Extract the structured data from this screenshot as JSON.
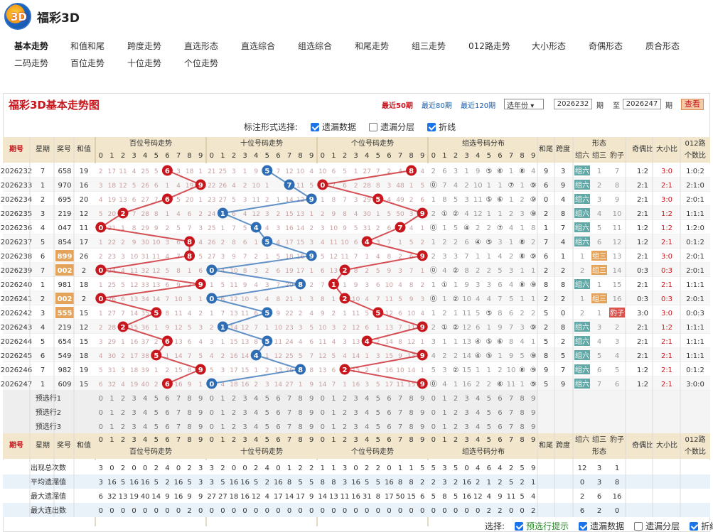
{
  "app": {
    "title": "福彩3D"
  },
  "nav": [
    "基本走势",
    "和值和尾",
    "跨度走势",
    "直选形态",
    "直选综合",
    "组选综合",
    "和尾走势",
    "组三走势",
    "012路走势",
    "大小形态",
    "奇偶形态",
    "质合形态",
    "二码走势",
    "百位走势",
    "十位走势",
    "个位走势"
  ],
  "panel": {
    "title": "福彩3D基本走势图",
    "recent50": "最近50期",
    "recent80": "最近80期",
    "recent120": "最近120期",
    "year_select": "选年份",
    "from_val": "2026232",
    "from_unit": "期",
    "to_label": "至",
    "to_val": "2026247",
    "to_unit": "期",
    "view_btn": "查看"
  },
  "options": {
    "label": "标注形式选择:",
    "missing": "遗漏数据",
    "layer": "遗漏分层",
    "line": "折线"
  },
  "header": {
    "issue": "期号",
    "week": "星期",
    "prize": "奖号",
    "sum": "和值",
    "hundreds": "百位号码走势",
    "tens": "十位号码走势",
    "units": "个位号码走势",
    "group": "组选号码分布",
    "tail": "和尾",
    "span": "跨度",
    "form": "形态",
    "g6": "组六",
    "g3": "组三",
    "leopard": "豹子",
    "odd_even": "奇偶比",
    "big_small": "大小比",
    "route": "012路",
    "route2": "个数比"
  },
  "digits": [
    "0",
    "1",
    "2",
    "3",
    "4",
    "5",
    "6",
    "7",
    "8",
    "9"
  ],
  "rows": [
    {
      "issue": "2026232",
      "week": "7",
      "prize": "658",
      "sum": "19",
      "h": 6,
      "t": 5,
      "u": 8,
      "hm": [
        "2",
        "17",
        "11",
        "4",
        "25",
        "5",
        "",
        "3",
        "18",
        "1"
      ],
      "tm": [
        "21",
        "25",
        "3",
        "1",
        "9",
        "",
        "7",
        "12",
        "10",
        "4"
      ],
      "um": [
        "10",
        "6",
        "5",
        "1",
        "27",
        "7",
        "2",
        "4",
        "",
        "4"
      ],
      "g": [
        "2",
        "6",
        "3",
        "1",
        "9",
        "⑤",
        "⑥",
        "1",
        "⑧",
        "4"
      ],
      "tail": "9",
      "span": "3",
      "form": "组六",
      "f3": "1",
      "f4": "7",
      "oe": "1:2",
      "bs": "3:0",
      "rt": "1:0:2"
    },
    {
      "issue": "2026233",
      "week": "1",
      "prize": "970",
      "sum": "16",
      "h": 9,
      "t": 7,
      "u": 0,
      "hm": [
        "3",
        "18",
        "12",
        "5",
        "26",
        "6",
        "1",
        "4",
        "19",
        ""
      ],
      "tm": [
        "22",
        "26",
        "4",
        "2",
        "10",
        "1",
        "",
        "13",
        "11",
        "5"
      ],
      "um": [
        "",
        "7",
        "6",
        "2",
        "28",
        "8",
        "3",
        "48",
        "1",
        "5"
      ],
      "g": [
        "⓪",
        "7",
        "4",
        "2",
        "10",
        "1",
        "1",
        "⑦",
        "1",
        "⑨"
      ],
      "tail": "6",
      "span": "9",
      "form": "组六",
      "f3": "2",
      "f4": "8",
      "oe": "2:1",
      "bs": "2:1",
      "rt": "2:1:0"
    },
    {
      "issue": "2026234",
      "week": "2",
      "prize": "695",
      "sum": "20",
      "h": 6,
      "t": 9,
      "u": 5,
      "hm": [
        "4",
        "19",
        "13",
        "6",
        "27",
        "7",
        "",
        "5",
        "20",
        "1"
      ],
      "tm": [
        "23",
        "27",
        "5",
        "3",
        "11",
        "2",
        "1",
        "14",
        "12",
        ""
      ],
      "um": [
        "1",
        "8",
        "7",
        "3",
        "29",
        "",
        "4",
        "49",
        "2",
        "6"
      ],
      "g": [
        "1",
        "8",
        "5",
        "3",
        "11",
        "⑤",
        "⑥",
        "1",
        "2",
        "⑨"
      ],
      "tail": "0",
      "span": "4",
      "form": "组六",
      "f3": "3",
      "f4": "9",
      "oe": "2:1",
      "bs": "3:0",
      "rt": "2:0:1"
    },
    {
      "issue": "2026235",
      "week": "3",
      "prize": "219",
      "sum": "12",
      "h": 2,
      "t": 1,
      "u": 9,
      "hm": [
        "5",
        "20",
        "",
        "7",
        "28",
        "8",
        "1",
        "4",
        "6",
        "2"
      ],
      "tm": [
        "24",
        "",
        "6",
        "4",
        "12",
        "3",
        "2",
        "15",
        "13",
        "1"
      ],
      "um": [
        "2",
        "9",
        "8",
        "4",
        "30",
        "1",
        "5",
        "50",
        "3",
        ""
      ],
      "g": [
        "2",
        "①",
        "②",
        "4",
        "12",
        "1",
        "1",
        "2",
        "3",
        "⑨"
      ],
      "tail": "2",
      "span": "8",
      "form": "组六",
      "f3": "4",
      "f4": "10",
      "oe": "2:1",
      "bs": "1:2",
      "rt": "1:1:1"
    },
    {
      "issue": "2026236",
      "week": "4",
      "prize": "047",
      "sum": "11",
      "h": 0,
      "t": 4,
      "u": 7,
      "hm": [
        "",
        "21",
        "1",
        "8",
        "29",
        "9",
        "2",
        "5",
        "7",
        "3"
      ],
      "tm": [
        "25",
        "1",
        "7",
        "5",
        "",
        "4",
        "3",
        "16",
        "14",
        "2"
      ],
      "um": [
        "3",
        "10",
        "9",
        "5",
        "31",
        "2",
        "6",
        "",
        "4",
        "1"
      ],
      "g": [
        "⓪",
        "1",
        "5",
        "④",
        "2",
        "2",
        "⑦",
        "4",
        "1",
        "8"
      ],
      "tail": "1",
      "span": "7",
      "form": "组六",
      "f3": "5",
      "f4": "11",
      "oe": "1:2",
      "bs": "1:2",
      "rt": "1:2:0"
    },
    {
      "issue": "2026237",
      "week": "5",
      "prize": "854",
      "sum": "17",
      "h": 8,
      "t": 5,
      "u": 4,
      "hm": [
        "1",
        "22",
        "2",
        "9",
        "30",
        "10",
        "3",
        "6",
        "",
        "4"
      ],
      "tm": [
        "26",
        "2",
        "8",
        "6",
        "1",
        "",
        "4",
        "17",
        "15",
        "3"
      ],
      "um": [
        "4",
        "11",
        "10",
        "6",
        "",
        "3",
        "7",
        "1",
        "5",
        "2"
      ],
      "g": [
        "1",
        "2",
        "2",
        "6",
        "④",
        "⑤",
        "3",
        "1",
        "⑧",
        "2"
      ],
      "tail": "7",
      "span": "4",
      "form": "组六",
      "f3": "6",
      "f4": "12",
      "oe": "1:2",
      "bs": "2:1",
      "rt": "0:1:2"
    },
    {
      "issue": "2026238",
      "week": "6",
      "prize": "899",
      "sum": "26",
      "h": 8,
      "t": 9,
      "u": 9,
      "hm": [
        "2",
        "23",
        "3",
        "10",
        "31",
        "11",
        "4",
        "7",
        "",
        "5"
      ],
      "tm": [
        "27",
        "3",
        "9",
        "7",
        "2",
        "1",
        "5",
        "18",
        "16",
        ""
      ],
      "um": [
        "5",
        "12",
        "11",
        "7",
        "1",
        "4",
        "8",
        "2",
        "6",
        ""
      ],
      "g": [
        "2",
        "3",
        "3",
        "7",
        "1",
        "1",
        "4",
        "2",
        "⑧",
        "⑨"
      ],
      "tail": "6",
      "span": "1",
      "form": "组三",
      "f3": "1",
      "f4": "13",
      "oe": "2:1",
      "bs": "3:0",
      "rt": "2:0:1"
    },
    {
      "issue": "2026239",
      "week": "7",
      "prize": "002",
      "sum": "2",
      "h": 0,
      "t": 0,
      "u": 2,
      "hm": [
        "",
        "24",
        "4",
        "11",
        "32",
        "12",
        "5",
        "8",
        "1",
        "6"
      ],
      "tm": [
        "",
        "4",
        "10",
        "8",
        "3",
        "2",
        "6",
        "19",
        "17",
        "1"
      ],
      "um": [
        "6",
        "13",
        "",
        "8",
        "2",
        "5",
        "9",
        "3",
        "7",
        "1"
      ],
      "g": [
        "⓪",
        "4",
        "②",
        "8",
        "2",
        "2",
        "5",
        "3",
        "1",
        "1"
      ],
      "tail": "2",
      "span": "2",
      "form": "组三",
      "f3": "2",
      "f4": "14",
      "oe": "0:3",
      "bs": "0:3",
      "rt": "2:0:1"
    },
    {
      "issue": "2026240",
      "week": "1",
      "prize": "981",
      "sum": "18",
      "h": 9,
      "t": 8,
      "u": 1,
      "hm": [
        "1",
        "25",
        "5",
        "12",
        "33",
        "13",
        "6",
        "9",
        "2",
        ""
      ],
      "tm": [
        "1",
        "5",
        "11",
        "9",
        "4",
        "3",
        "7",
        "20",
        "",
        "2"
      ],
      "um": [
        "7",
        "",
        "1",
        "9",
        "3",
        "6",
        "10",
        "4",
        "8",
        "2"
      ],
      "g": [
        "1",
        "①",
        "1",
        "9",
        "3",
        "3",
        "6",
        "4",
        "⑧",
        "⑨"
      ],
      "tail": "8",
      "span": "8",
      "form": "组六",
      "f3": "1",
      "f4": "15",
      "oe": "2:1",
      "bs": "2:1",
      "rt": "1:1:1"
    },
    {
      "issue": "2026241",
      "week": "2",
      "prize": "002",
      "sum": "2",
      "h": 0,
      "t": 0,
      "u": 2,
      "hm": [
        "",
        "26",
        "6",
        "13",
        "34",
        "14",
        "7",
        "10",
        "3",
        "1"
      ],
      "tm": [
        "",
        "6",
        "12",
        "10",
        "5",
        "4",
        "8",
        "21",
        "1",
        "3"
      ],
      "um": [
        "8",
        "1",
        "",
        "10",
        "4",
        "7",
        "11",
        "5",
        "9",
        "3"
      ],
      "g": [
        "⓪",
        "1",
        "②",
        "10",
        "4",
        "4",
        "7",
        "5",
        "1",
        "1"
      ],
      "tail": "2",
      "span": "2",
      "form": "组三",
      "f3": "1",
      "f4": "16",
      "oe": "0:3",
      "bs": "0:3",
      "rt": "2:0:1"
    },
    {
      "issue": "2026242",
      "week": "3",
      "prize": "555",
      "sum": "15",
      "h": 5,
      "t": 5,
      "u": 5,
      "hm": [
        "1",
        "27",
        "7",
        "14",
        "35",
        "",
        "8",
        "11",
        "4",
        "2"
      ],
      "tm": [
        "1",
        "7",
        "13",
        "11",
        "6",
        "",
        "9",
        "22",
        "2",
        "4"
      ],
      "um": [
        "9",
        "2",
        "1",
        "11",
        "5",
        "",
        "12",
        "6",
        "10",
        "4"
      ],
      "g": [
        "1",
        "2",
        "1",
        "11",
        "5",
        "⑤",
        "8",
        "6",
        "2",
        "2"
      ],
      "tail": "5",
      "span": "0",
      "form": "豹子",
      "f3": "2",
      "f4": "1",
      "oe": "3:0",
      "bs": "3:0",
      "rt": "0:0:3"
    },
    {
      "issue": "2026243",
      "week": "4",
      "prize": "219",
      "sum": "12",
      "h": 2,
      "t": 1,
      "u": 9,
      "hm": [
        "2",
        "28",
        "",
        "15",
        "36",
        "1",
        "9",
        "12",
        "5",
        "3"
      ],
      "tm": [
        "2",
        "",
        "14",
        "12",
        "7",
        "1",
        "10",
        "23",
        "3",
        "5"
      ],
      "um": [
        "10",
        "3",
        "2",
        "12",
        "6",
        "1",
        "13",
        "7",
        "11",
        ""
      ],
      "g": [
        "2",
        "①",
        "②",
        "12",
        "6",
        "1",
        "9",
        "7",
        "3",
        "⑨"
      ],
      "tail": "2",
      "span": "8",
      "form": "组六",
      "f3": "3",
      "f4": "2",
      "oe": "2:1",
      "bs": "1:2",
      "rt": "1:1:1"
    },
    {
      "issue": "2026244",
      "week": "5",
      "prize": "654",
      "sum": "15",
      "h": 6,
      "t": 5,
      "u": 4,
      "hm": [
        "3",
        "29",
        "1",
        "16",
        "37",
        "2",
        "",
        "13",
        "6",
        "4"
      ],
      "tm": [
        "3",
        "1",
        "15",
        "13",
        "8",
        "",
        "11",
        "24",
        "4",
        "6"
      ],
      "um": [
        "11",
        "4",
        "3",
        "13",
        "",
        "2",
        "14",
        "8",
        "12",
        "1"
      ],
      "g": [
        "3",
        "1",
        "1",
        "13",
        "④",
        "⑤",
        "⑥",
        "8",
        "4",
        "1"
      ],
      "tail": "5",
      "span": "2",
      "form": "组六",
      "f3": "4",
      "f4": "3",
      "oe": "2:1",
      "bs": "2:1",
      "rt": "1:1:1"
    },
    {
      "issue": "2026245",
      "week": "6",
      "prize": "549",
      "sum": "18",
      "h": 5,
      "t": 4,
      "u": 9,
      "hm": [
        "4",
        "30",
        "2",
        "17",
        "38",
        "",
        "1",
        "14",
        "7",
        "5"
      ],
      "tm": [
        "4",
        "2",
        "16",
        "14",
        "",
        "1",
        "12",
        "25",
        "5",
        "7"
      ],
      "um": [
        "12",
        "5",
        "4",
        "14",
        "1",
        "3",
        "15",
        "9",
        "13",
        ""
      ],
      "g": [
        "4",
        "2",
        "2",
        "14",
        "④",
        "⑤",
        "1",
        "9",
        "5",
        "⑨"
      ],
      "tail": "8",
      "span": "5",
      "form": "组六",
      "f3": "5",
      "f4": "4",
      "oe": "2:1",
      "bs": "2:1",
      "rt": "1:1:1"
    },
    {
      "issue": "2026246",
      "week": "7",
      "prize": "982",
      "sum": "19",
      "h": 9,
      "t": 8,
      "u": 2,
      "hm": [
        "5",
        "31",
        "3",
        "18",
        "39",
        "1",
        "2",
        "15",
        "8",
        ""
      ],
      "tm": [
        "5",
        "3",
        "17",
        "15",
        "1",
        "2",
        "13",
        "26",
        "",
        "8"
      ],
      "um": [
        "13",
        "6",
        "",
        "15",
        "2",
        "4",
        "16",
        "10",
        "14",
        "1"
      ],
      "g": [
        "5",
        "3",
        "②",
        "15",
        "1",
        "1",
        "2",
        "10",
        "⑧",
        "⑨"
      ],
      "tail": "9",
      "span": "7",
      "form": "组六",
      "f3": "6",
      "f4": "5",
      "oe": "1:2",
      "bs": "2:1",
      "rt": "0:1:2"
    },
    {
      "issue": "2026247",
      "week": "1",
      "prize": "609",
      "sum": "15",
      "h": 6,
      "t": 0,
      "u": 9,
      "hm": [
        "6",
        "32",
        "4",
        "19",
        "40",
        "2",
        "",
        "16",
        "9",
        "1"
      ],
      "tm": [
        "",
        "4",
        "18",
        "16",
        "2",
        "3",
        "14",
        "27",
        "1",
        "9"
      ],
      "um": [
        "14",
        "7",
        "1",
        "16",
        "3",
        "5",
        "17",
        "11",
        "15",
        ""
      ],
      "g": [
        "⓪",
        "4",
        "1",
        "16",
        "2",
        "2",
        "⑥",
        "11",
        "1",
        "⑨"
      ],
      "tail": "5",
      "span": "9",
      "form": "组六",
      "f3": "7",
      "f4": "6",
      "oe": "1:2",
      "bs": "2:1",
      "rt": "3:0:0"
    }
  ],
  "pre": [
    "预选行1",
    "预选行2",
    "预选行3"
  ],
  "stats": [
    {
      "label": "出现总次数",
      "h": [
        "3",
        "0",
        "2",
        "0",
        "0",
        "2",
        "4",
        "0",
        "2",
        "3"
      ],
      "t": [
        "3",
        "2",
        "0",
        "0",
        "2",
        "4",
        "0",
        "1",
        "2",
        "2"
      ],
      "u": [
        "1",
        "1",
        "3",
        "0",
        "2",
        "2",
        "0",
        "1",
        "1",
        "5"
      ],
      "g": [
        "5",
        "3",
        "5",
        "0",
        "4",
        "6",
        "4",
        "2",
        "5",
        "9"
      ],
      "f": [
        "12",
        "3",
        "1"
      ]
    },
    {
      "label": "平均遗漏值",
      "h": [
        "3",
        "16",
        "5",
        "16",
        "16",
        "5",
        "2",
        "16",
        "5",
        "3"
      ],
      "t": [
        "3",
        "5",
        "16",
        "16",
        "5",
        "2",
        "16",
        "8",
        "5",
        "5"
      ],
      "u": [
        "8",
        "8",
        "3",
        "16",
        "5",
        "5",
        "16",
        "8",
        "8",
        "2"
      ],
      "g": [
        "2",
        "3",
        "2",
        "16",
        "2",
        "1",
        "2",
        "5",
        "2",
        "1"
      ],
      "f": [
        "0",
        "3",
        "8"
      ]
    },
    {
      "label": "最大遗漏值",
      "h": [
        "6",
        "32",
        "13",
        "19",
        "40",
        "14",
        "9",
        "16",
        "9",
        "9"
      ],
      "t": [
        "27",
        "27",
        "18",
        "16",
        "12",
        "4",
        "17",
        "14",
        "17",
        "9"
      ],
      "u": [
        "14",
        "13",
        "11",
        "16",
        "31",
        "8",
        "17",
        "50",
        "15",
        "6"
      ],
      "g": [
        "5",
        "8",
        "5",
        "16",
        "12",
        "4",
        "9",
        "11",
        "5",
        "4"
      ],
      "f": [
        "2",
        "6",
        "16"
      ]
    },
    {
      "label": "最大连出数",
      "h": [
        "0",
        "0",
        "0",
        "0",
        "0",
        "0",
        "0",
        "0",
        "2",
        "0"
      ],
      "t": [
        "0",
        "0",
        "0",
        "0",
        "0",
        "0",
        "0",
        "0",
        "0",
        "0"
      ],
      "u": [
        "0",
        "0",
        "0",
        "0",
        "0",
        "0",
        "0",
        "0",
        "0",
        "0"
      ],
      "g": [
        "0",
        "0",
        "0",
        "0",
        "0",
        "2",
        "2",
        "0",
        "0",
        "2"
      ],
      "f": [
        "6",
        "2",
        "0"
      ]
    }
  ],
  "footer": {
    "label": "选择:",
    "pre": "预选行提示",
    "missing": "遗漏数据",
    "layer": "遗漏分层",
    "line": "折线"
  },
  "colors": {
    "red": "#c8161d",
    "blue": "#2e6db4",
    "header_bg": "#f2e6cc",
    "form_g6": "#62a8a6",
    "form_g3": "#e3a35a",
    "form_bz": "#d9534f"
  }
}
